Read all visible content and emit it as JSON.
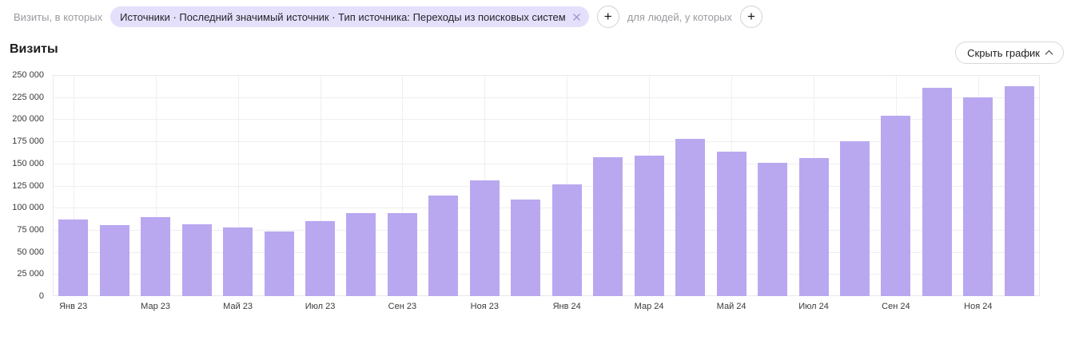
{
  "filter_bar": {
    "visits_prefix_label": "Визиты, в которых",
    "segment_chip_text": "Источники · Последний значимый источник · Тип источника: Переходы из поисковых систем",
    "people_prefix_label": "для людей, у которых",
    "plus_icon_glyph": "+",
    "chip_bg_color": "#e4e0fb"
  },
  "section": {
    "title": "Визиты",
    "hide_chart_button_label": "Скрыть график"
  },
  "chart_data": {
    "type": "bar",
    "title": "Визиты",
    "bar_color": "#b9a8f0",
    "grid": true,
    "legend": false,
    "ylim": [
      0,
      250000
    ],
    "y_tick_step": 25000,
    "y_tick_labels": [
      "0",
      "25 000",
      "50 000",
      "75 000",
      "100 000",
      "125 000",
      "150 000",
      "175 000",
      "200 000",
      "225 000",
      "250 000"
    ],
    "x_tick_labels": [
      "Янв 23",
      "Мар 23",
      "Май 23",
      "Июл 23",
      "Сен 23",
      "Ноя 23",
      "Янв 24",
      "Мар 24",
      "Май 24",
      "Июл 24",
      "Сен 24",
      "Ноя 24"
    ],
    "x_tick_every": 2,
    "categories": [
      "Янв 23",
      "Фев 23",
      "Мар 23",
      "Апр 23",
      "Май 23",
      "Июн 23",
      "Июл 23",
      "Авг 23",
      "Сен 23",
      "Окт 23",
      "Ноя 23",
      "Дек 23",
      "Янв 24",
      "Фев 24",
      "Мар 24",
      "Апр 24",
      "Май 24",
      "Июн 24",
      "Июл 24",
      "Авг 24",
      "Сен 24",
      "Окт 24",
      "Ноя 24",
      "Дек 24"
    ],
    "series": [
      {
        "name": "Визиты",
        "values": [
          87000,
          80000,
          89000,
          81000,
          78000,
          73000,
          85000,
          94000,
          94000,
          114000,
          131000,
          109000,
          126000,
          157000,
          159000,
          178000,
          163000,
          151000,
          156000,
          175000,
          204000,
          236000,
          225000,
          237000
        ]
      }
    ]
  }
}
